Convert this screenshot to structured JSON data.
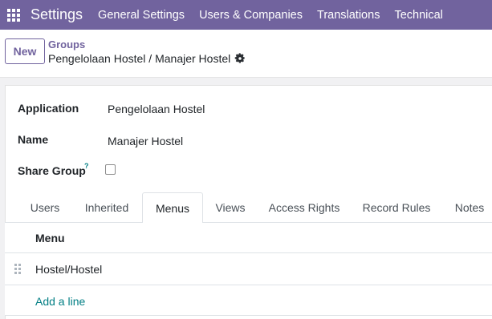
{
  "navbar": {
    "brand": "Settings",
    "items": [
      "General Settings",
      "Users & Companies",
      "Translations",
      "Technical"
    ],
    "color": "#71639e"
  },
  "control": {
    "new_label": "New",
    "breadcrumb_parent": "Groups",
    "breadcrumb_current": "Pengelolaan Hostel / Manajer Hostel"
  },
  "form": {
    "application_label": "Application",
    "application_value": "Pengelolaan Hostel",
    "name_label": "Name",
    "name_value": "Manajer Hostel",
    "share_group_label": "Share Group",
    "share_group_help": "?",
    "share_group_checked": false
  },
  "tabs": [
    {
      "label": "Users",
      "active": false
    },
    {
      "label": "Inherited",
      "active": false
    },
    {
      "label": "Menus",
      "active": true
    },
    {
      "label": "Views",
      "active": false
    },
    {
      "label": "Access Rights",
      "active": false
    },
    {
      "label": "Record Rules",
      "active": false
    },
    {
      "label": "Notes",
      "active": false
    }
  ],
  "menus_list": {
    "column_header": "Menu",
    "rows": [
      "Hostel/Hostel"
    ],
    "add_line_label": "Add a line"
  }
}
